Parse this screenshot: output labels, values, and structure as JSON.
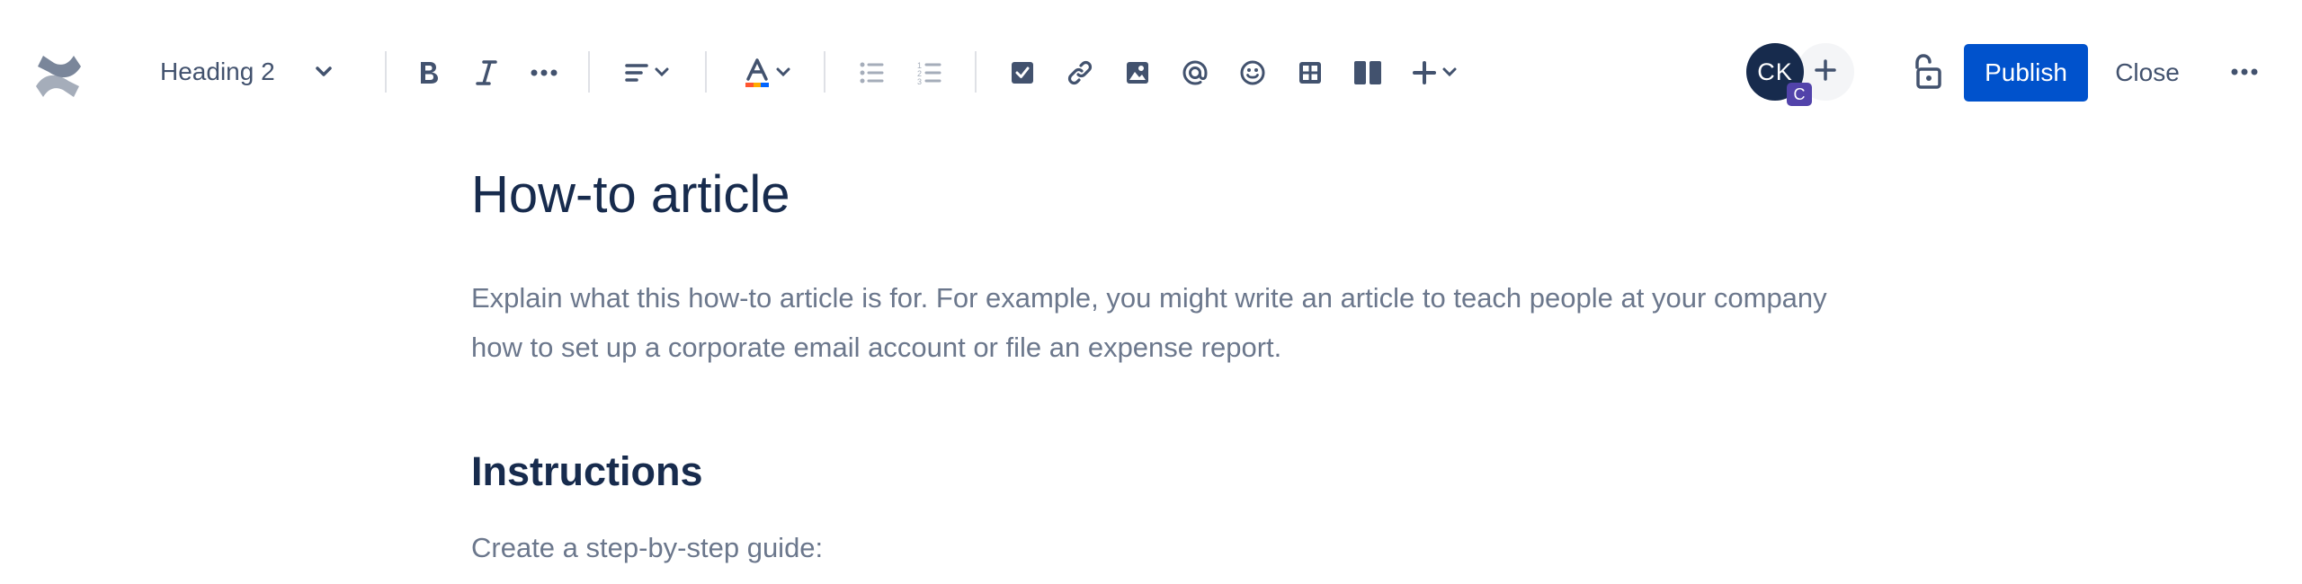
{
  "toolbar": {
    "text_style": "Heading 2",
    "publish_label": "Publish",
    "close_label": "Close"
  },
  "collaborators": {
    "avatar_initials": "CK",
    "avatar_badge": "C"
  },
  "colors": {
    "primary": "#0052cc",
    "text_dark": "#172b4d",
    "text_muted": "#6b778c",
    "icon": "#42526e",
    "badge": "#5243aa"
  },
  "icons": [
    "confluence-logo",
    "chevron-down-icon",
    "bold-icon",
    "italic-icon",
    "more-formatting-icon",
    "align-icon",
    "text-color-icon",
    "bullet-list-icon",
    "numbered-list-icon",
    "checkbox-icon",
    "link-icon",
    "image-icon",
    "mention-icon",
    "emoji-icon",
    "table-icon",
    "layout-icon",
    "insert-icon",
    "plus-icon",
    "unlock-icon",
    "more-icon"
  ],
  "document": {
    "title": "How-to article",
    "intro": "Explain what this how-to article is for. For example, you might write an article to teach people at your company how to set up a corporate email account or file an expense report.",
    "section_heading": "Instructions",
    "section_text": "Create a step-by-step guide:"
  }
}
